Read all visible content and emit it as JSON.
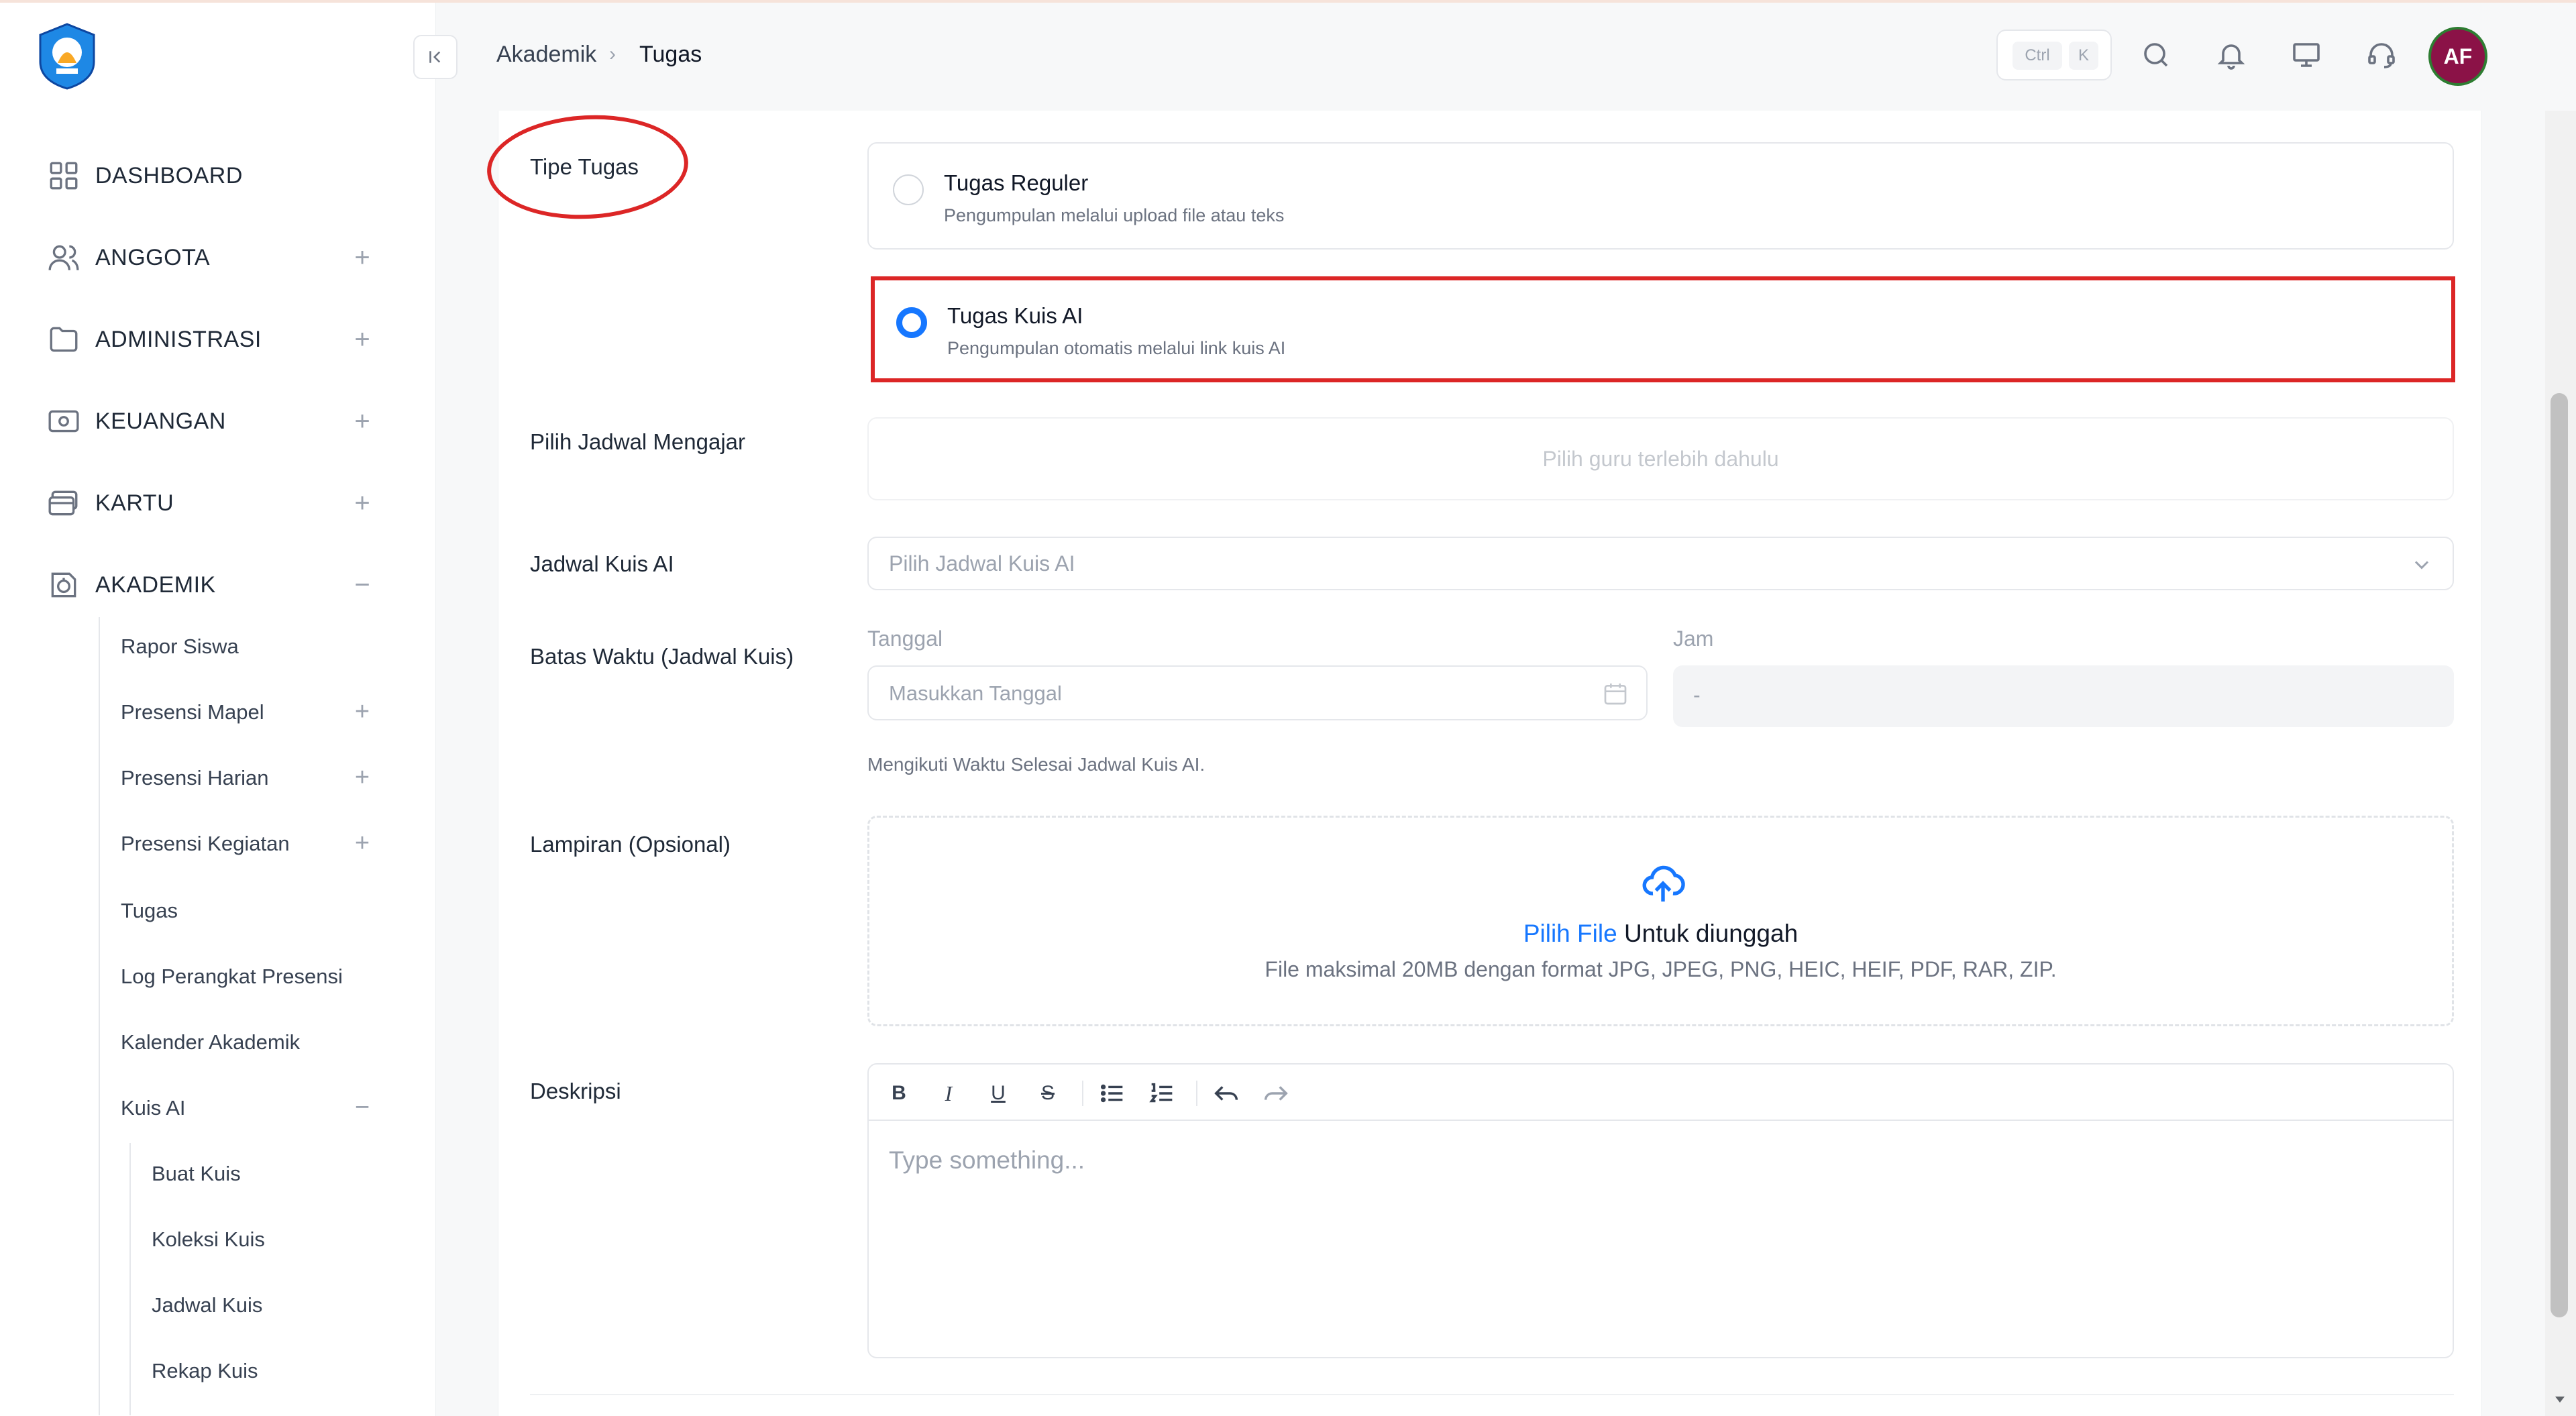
{
  "header": {
    "breadcrumb": [
      "Akademik",
      "Tugas"
    ],
    "shortcut_keys": [
      "Ctrl",
      "K"
    ],
    "avatar_initials": "AF"
  },
  "sidebar": {
    "items": [
      {
        "label": "DASHBOARD",
        "icon": "grid-icon",
        "toggle": ""
      },
      {
        "label": "ANGGOTA",
        "icon": "users-icon",
        "toggle": "+"
      },
      {
        "label": "ADMINISTRASI",
        "icon": "folder-icon",
        "toggle": "+"
      },
      {
        "label": "KEUANGAN",
        "icon": "money-icon",
        "toggle": "+"
      },
      {
        "label": "KARTU",
        "icon": "card-icon",
        "toggle": "+"
      },
      {
        "label": "AKADEMIK",
        "icon": "academic-icon",
        "toggle": "−"
      }
    ],
    "akademik_sub": [
      {
        "label": "Rapor Siswa",
        "toggle": ""
      },
      {
        "label": "Presensi Mapel",
        "toggle": "+"
      },
      {
        "label": "Presensi Harian",
        "toggle": "+"
      },
      {
        "label": "Presensi Kegiatan",
        "toggle": "+"
      },
      {
        "label": "Tugas",
        "toggle": ""
      },
      {
        "label": "Log Perangkat Presensi",
        "toggle": ""
      },
      {
        "label": "Kalender Akademik",
        "toggle": ""
      },
      {
        "label": "Kuis AI",
        "toggle": "−"
      }
    ],
    "kuis_sub": [
      "Buat Kuis",
      "Koleksi Kuis",
      "Jadwal Kuis",
      "Rekap Kuis"
    ]
  },
  "form": {
    "tipe_tugas": {
      "label": "Tipe Tugas",
      "options": [
        {
          "title": "Tugas Reguler",
          "desc": "Pengumpulan melalui upload file atau teks",
          "selected": false
        },
        {
          "title": "Tugas Kuis AI",
          "desc": "Pengumpulan otomatis melalui link kuis AI",
          "selected": true
        }
      ]
    },
    "jadwal_mengajar": {
      "label": "Pilih Jadwal Mengajar",
      "placeholder": "Pilih guru terlebih dahulu"
    },
    "jadwal_kuis": {
      "label": "Jadwal Kuis AI",
      "placeholder": "Pilih Jadwal Kuis AI"
    },
    "batas_waktu": {
      "label": "Batas Waktu (Jadwal Kuis)",
      "date_label": "Tanggal",
      "date_placeholder": "Masukkan Tanggal",
      "time_label": "Jam",
      "time_value": "-",
      "hint": "Mengikuti Waktu Selesai Jadwal Kuis AI."
    },
    "lampiran": {
      "label": "Lampiran (Opsional)",
      "link": "Pilih File",
      "text": " Untuk diunggah",
      "formats": "File maksimal 20MB dengan format JPG, JPEG, PNG, HEIC, HEIF, PDF, RAR, ZIP."
    },
    "deskripsi": {
      "label": "Deskripsi",
      "placeholder": "Type something..."
    }
  },
  "colors": {
    "accent": "#1677ff",
    "annotation": "#dc2626",
    "avatar_bg": "#8b1247",
    "avatar_ring": "#2e7d32"
  }
}
